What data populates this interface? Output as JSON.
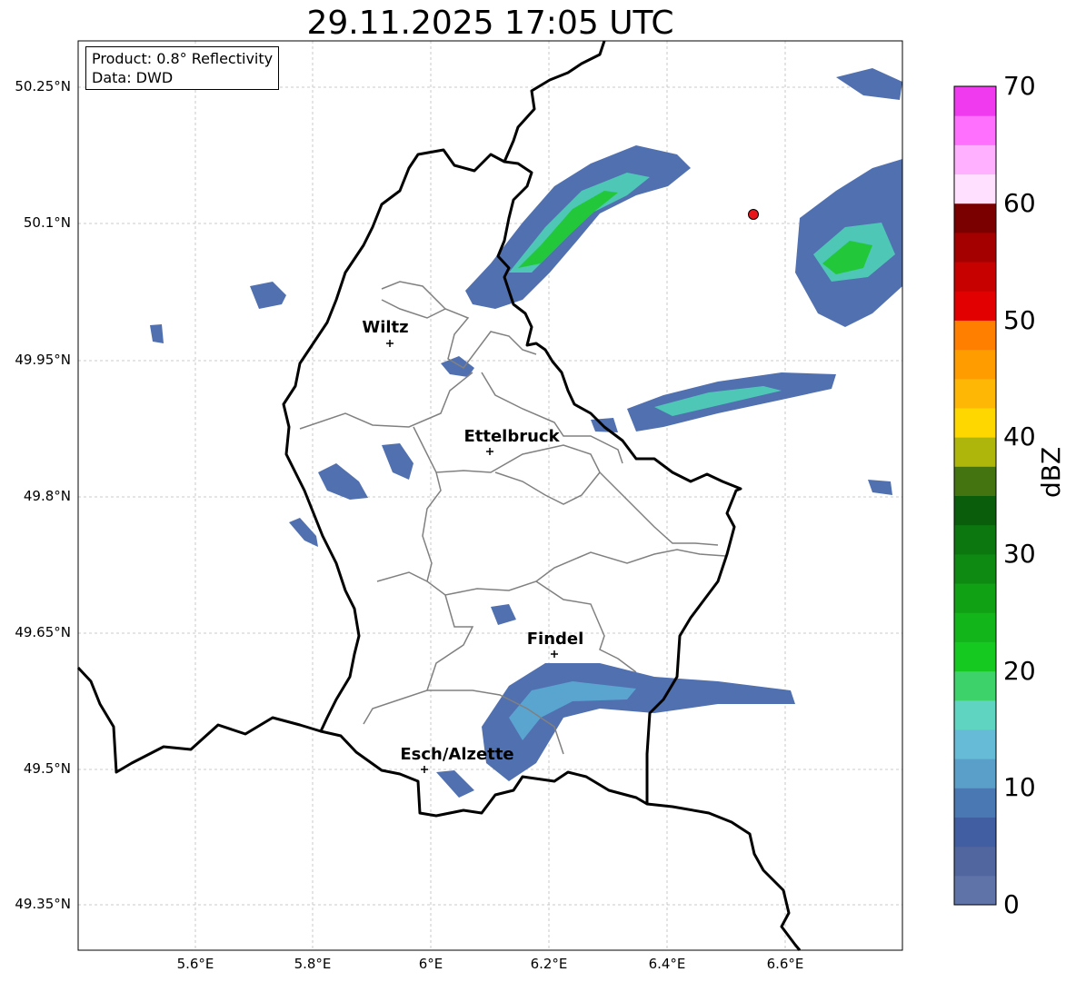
{
  "title": "29.11.2025 17:05 UTC",
  "info_box": {
    "product": "Product: 0.8° Reflectivity",
    "source": "Data: DWD"
  },
  "lat_ticks": [
    "50.25°N",
    "50.1°N",
    "49.95°N",
    "49.8°N",
    "49.65°N",
    "49.5°N",
    "49.35°N"
  ],
  "lon_ticks": [
    "5.6°E",
    "5.8°E",
    "6°E",
    "6.2°E",
    "6.4°E",
    "6.6°E"
  ],
  "cities": [
    {
      "name": "Wiltz",
      "marker": "+"
    },
    {
      "name": "Ettelbruck",
      "marker": "+"
    },
    {
      "name": "Findel",
      "marker": "+"
    },
    {
      "name": "Esch/Alzette",
      "marker": "+"
    }
  ],
  "colorbar": {
    "label": "dBZ",
    "ticks": [
      "0",
      "10",
      "20",
      "30",
      "40",
      "50",
      "60",
      "70"
    ],
    "colors": [
      "#6073a8",
      "#51669f",
      "#425ea2",
      "#4978b2",
      "#5a9fc9",
      "#66bcd7",
      "#5fd4c0",
      "#3dd26a",
      "#15c920",
      "#12b61b",
      "#11a115",
      "#0e8a12",
      "#0c760f",
      "#0a5e0b",
      "#437410",
      "#aeb50b",
      "#ffd700",
      "#ffb705",
      "#ff9c00",
      "#ff7f00",
      "#e30000",
      "#c70000",
      "#a40000",
      "#7a0000",
      "#ffe0ff",
      "#ffb0ff",
      "#ff70ff",
      "#ef3aef"
    ]
  }
}
